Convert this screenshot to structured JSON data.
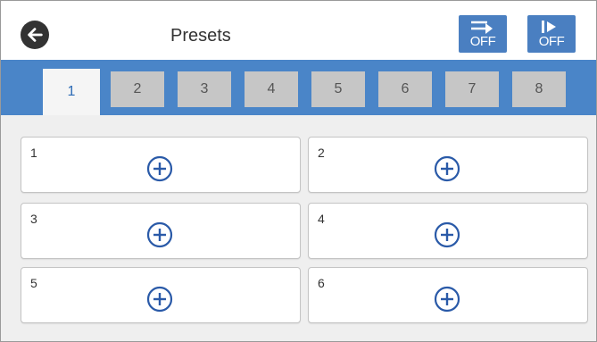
{
  "header": {
    "title": "Presets",
    "icon_a_label": "OFF",
    "icon_b_label": "OFF"
  },
  "tabs": [
    {
      "label": "1",
      "active": true
    },
    {
      "label": "2",
      "active": false
    },
    {
      "label": "3",
      "active": false
    },
    {
      "label": "4",
      "active": false
    },
    {
      "label": "5",
      "active": false
    },
    {
      "label": "6",
      "active": false
    },
    {
      "label": "7",
      "active": false
    },
    {
      "label": "8",
      "active": false
    }
  ],
  "slots": [
    {
      "number": "1"
    },
    {
      "number": "2"
    },
    {
      "number": "3"
    },
    {
      "number": "4"
    },
    {
      "number": "5"
    },
    {
      "number": "6"
    }
  ],
  "colors": {
    "accent": "#4a85c8",
    "icon_blue": "#2a5aa8",
    "tab_inactive": "#c6c6c6"
  }
}
